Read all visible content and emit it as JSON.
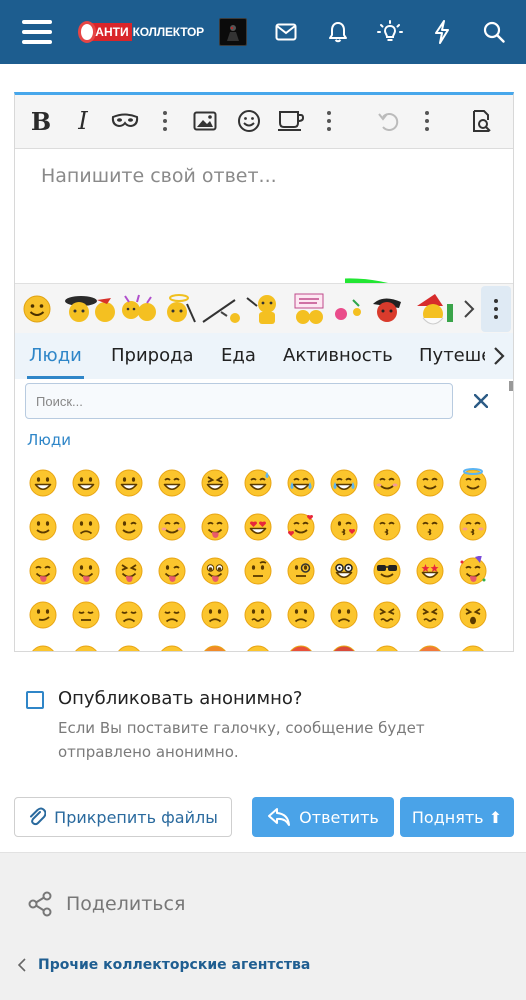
{
  "header": {
    "logo": {
      "part1": "АНТИ",
      "part2": "КОЛЛЕКТОР"
    },
    "icons": [
      "menu-icon",
      "mail-icon",
      "bell-icon",
      "lightbulb-icon",
      "lightning-icon",
      "search-icon"
    ],
    "color": "#1d5d8f"
  },
  "editor": {
    "placeholder": "Напишите свой ответ...",
    "toolbar_icons": [
      "bold-icon",
      "italic-icon",
      "mask-icon",
      "more-icon",
      "image-icon",
      "smile-icon",
      "media-icon",
      "more-icon",
      "undo-icon",
      "more-icon",
      "preview-icon"
    ],
    "bold_label": "B",
    "italic_label": "I",
    "accent": "#47a7eb"
  },
  "emoji_picker": {
    "tabs": [
      {
        "label": "Люди",
        "active": true
      },
      {
        "label": "Природа"
      },
      {
        "label": "Еда"
      },
      {
        "label": "Активность"
      },
      {
        "label": "Путешествия"
      }
    ],
    "search_placeholder": "Поиск...",
    "category": "Люди",
    "emojis": [
      "grin",
      "grin",
      "grin",
      "beam",
      "squint",
      "sweat-smile",
      "joy",
      "rofl",
      "blush-smile",
      "smile",
      "halo",
      "slight-smile",
      "upside-down",
      "wink",
      "relieved",
      "yum",
      "heart-eyes",
      "hearts",
      "kiss",
      "kiss-closed",
      "kiss-smile",
      "kiss-blush",
      "yum-tongue",
      "tongue",
      "squint-tongue",
      "wink-tongue",
      "zany",
      "raised-brow",
      "monocle",
      "nerd",
      "sunglasses",
      "star-struck",
      "party",
      "smirk",
      "unamused",
      "disappointed",
      "pensive",
      "worried",
      "confused",
      "slight-frown",
      "frown",
      "persevere",
      "confounded",
      "tired",
      "weary",
      "pleading",
      "cry",
      "sob",
      "angry",
      "steam",
      "rage",
      "swear",
      "flushed",
      "hot",
      "scream"
    ]
  },
  "options": {
    "anonymous_label": "Опубликовать анонимно?",
    "anonymous_hint": "Если Вы поставите галочку, сообщение будет отправлено анонимно.",
    "checked": false
  },
  "buttons": {
    "attach": "Прикрепить файлы",
    "reply": "Ответить",
    "bump": "Поднять ⬆"
  },
  "footer": {
    "share": "Поделиться",
    "breadcrumb": "Прочие коллекторские агентства"
  }
}
